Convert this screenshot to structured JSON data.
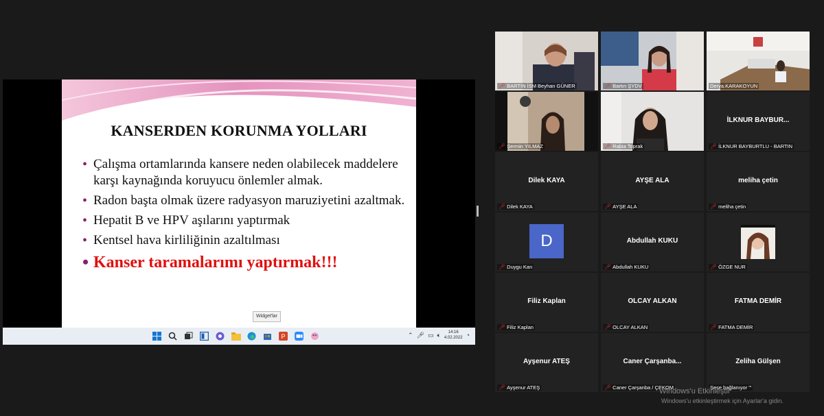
{
  "slide": {
    "title": "KANSERDEN KORUNMA YOLLARI",
    "bullets": [
      "Çalışma ortamlarında kansere neden olabilecek maddelere karşı kaynağında koruyucu önlemler almak.",
      "Radon başta olmak üzere radyasyon maruziyetini azaltmak.",
      "Hepatit B ve HPV aşılarını yaptırmak",
      "Kentsel hava kirliliğinin azaltılması",
      "Kanser taramalarımı yaptırmak!!!"
    ]
  },
  "taskbar": {
    "widget_tooltip": "Widget'lar",
    "time": "14:16",
    "date": "4.02.2022"
  },
  "participants": [
    {
      "name": "BARTIN İSM Beyhan GÜNER",
      "big_name": "",
      "video": true
    },
    {
      "name": "Bartın ŞYDV",
      "big_name": "",
      "video": true
    },
    {
      "name": "Derya.KARAKOYUN",
      "big_name": "",
      "video": true,
      "active": true
    },
    {
      "name": "Şermin YILMAZ",
      "big_name": "",
      "video": true
    },
    {
      "name": "Rabia Toprak",
      "big_name": "",
      "video": true
    },
    {
      "name": "İLKNUR BAYBURTLU - BARTIN",
      "big_name": "İLKNUR  BAYBUR...",
      "video": false
    },
    {
      "name": "Dilek KAYA",
      "big_name": "Dilek KAYA",
      "video": false
    },
    {
      "name": "AYŞE ALA",
      "big_name": "AYŞE ALA",
      "video": false
    },
    {
      "name": "meliha çetin",
      "big_name": "meliha çetin",
      "video": false
    },
    {
      "name": "Duygu Kan",
      "big_name": "D",
      "video": false
    },
    {
      "name": "Abdullah KUKU",
      "big_name": "Abdullah KUKU",
      "video": false
    },
    {
      "name": "ÖZGE NUR",
      "big_name": "",
      "video": true
    },
    {
      "name": "Filiz  Kaplan",
      "big_name": "Filiz  Kaplan",
      "video": false
    },
    {
      "name": "OLCAY ALKAN",
      "big_name": "OLCAY ALKAN",
      "video": false
    },
    {
      "name": "FATMA DEMİR",
      "big_name": "FATMA DEMİR",
      "video": false
    },
    {
      "name": "Ayşenur ATEŞ",
      "big_name": "Ayşenur ATEŞ",
      "video": false
    },
    {
      "name": "Caner Çarşanba / ÇEKOM",
      "big_name": "Caner Çarşanba...",
      "video": false
    },
    {
      "name": "Sese bağlanıyor '\"",
      "big_name": "Zeliha Gülşen",
      "video": false
    }
  ],
  "watermark": {
    "title": "Windows'u Etkinleştir",
    "subtitle": "Windows'u etkinleştirmek için Ayarlar'a gidin."
  },
  "colors": {
    "active_speaker": "#e2dd55",
    "mute_icon": "#e23030",
    "slide_accent": "#e6a0c8",
    "alert_text": "#e01010"
  }
}
